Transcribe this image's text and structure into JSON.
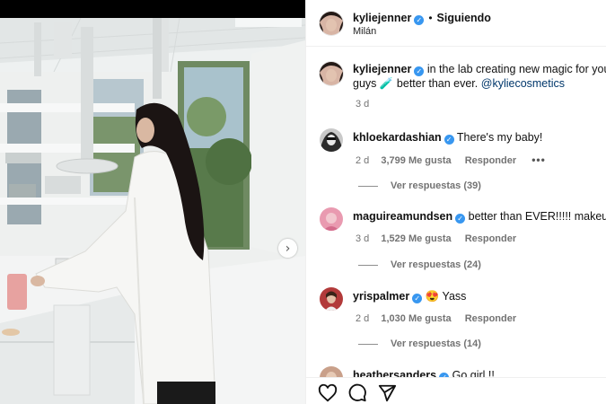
{
  "post": {
    "username": "kyliejenner",
    "follow_status": "Siguiendo",
    "location": "Milán",
    "caption_text": "in the lab creating new magic for you guys 🧪 better than ever.",
    "caption_mention": "@kyliecosmetics",
    "caption_time": "3 d"
  },
  "comments": [
    {
      "username": "khloekardashian",
      "text": "There's my baby!",
      "time": "2 d",
      "likes": "3,799 Me gusta",
      "reply_label": "Responder",
      "view_replies": "Ver respuestas (39)"
    },
    {
      "username": "maguireamundsen",
      "text": "better than EVER!!!!! makeup b",
      "time": "3 d",
      "likes": "1,529 Me gusta",
      "reply_label": "Responder",
      "view_replies": "Ver respuestas (24)"
    },
    {
      "username": "yrispalmer",
      "text": "😍 Yass",
      "time": "2 d",
      "likes": "1,030 Me gusta",
      "reply_label": "Responder",
      "view_replies": "Ver respuestas (14)"
    },
    {
      "username": "heathersanders",
      "text": "Go girl !!"
    }
  ],
  "icons": {
    "like": "heart-icon",
    "comment": "comment-icon",
    "share": "paper-plane-icon",
    "next": "chevron-right-icon",
    "verified": "verified-badge-icon"
  },
  "colors": {
    "link": "#00376b",
    "verified": "#3897f0",
    "meta": "#737373"
  }
}
